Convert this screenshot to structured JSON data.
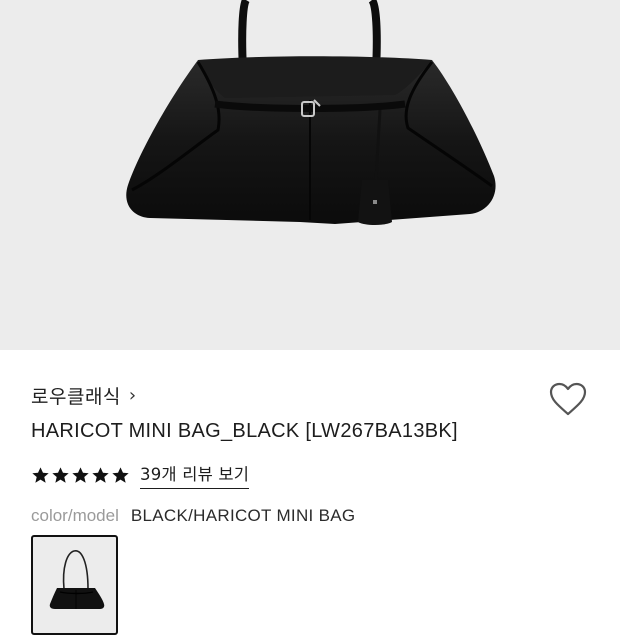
{
  "product": {
    "brand": "로우클래식",
    "brand_chevron": "›",
    "title": "HARICOT MINI BAG_BLACK [LW267BA13BK]",
    "rating": 5,
    "review_link": "39개 리뷰 보기",
    "option_key": "color/model",
    "option_value": "BLACK/HARICOT MINI BAG"
  },
  "icons": {
    "wishlist": "heart-outline-icon",
    "star": "star-filled-icon",
    "chevron": "chevron-right-icon"
  },
  "colors": {
    "image_bg": "#ececec",
    "text": "#1d1d1d",
    "muted": "#9a9a9a"
  }
}
